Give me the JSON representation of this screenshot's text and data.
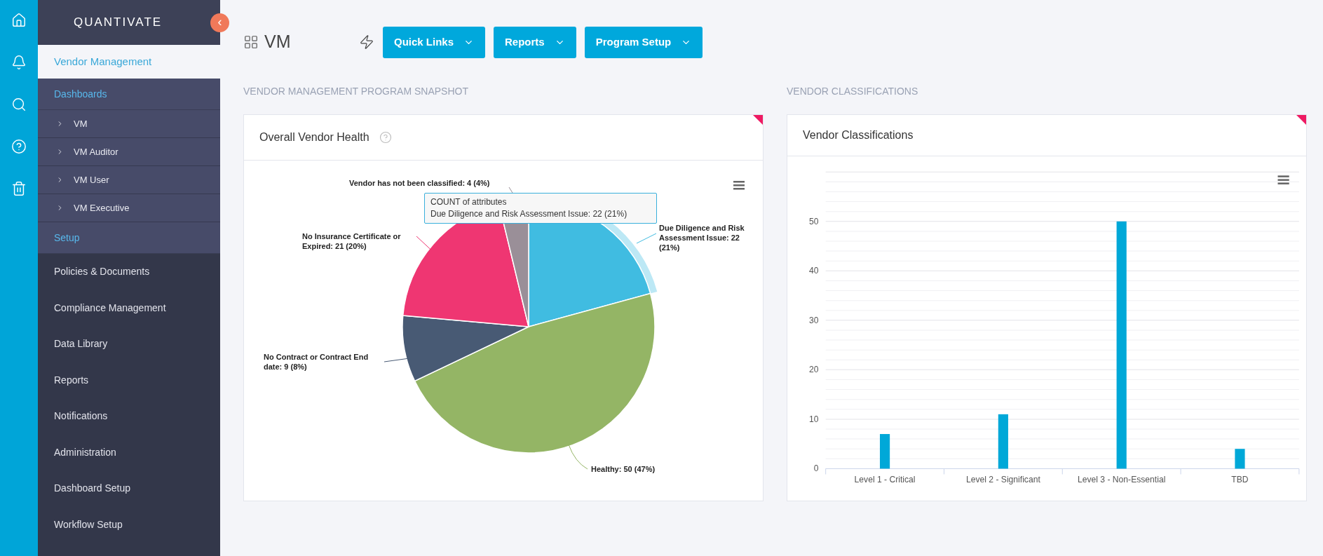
{
  "sidebar": {
    "logo": "QUANTIVATE",
    "collapse_glyph": "‹",
    "items": [
      {
        "kind": "module",
        "label": "Vendor Management"
      },
      {
        "kind": "group",
        "label": "Dashboards"
      },
      {
        "kind": "sub",
        "label": "VM"
      },
      {
        "kind": "sub",
        "label": "VM Auditor"
      },
      {
        "kind": "sub",
        "label": "VM User"
      },
      {
        "kind": "sub",
        "label": "VM Executive"
      },
      {
        "kind": "group",
        "label": "Setup"
      },
      {
        "kind": "link",
        "label": "Policies & Documents"
      },
      {
        "kind": "link",
        "label": "Compliance Management"
      },
      {
        "kind": "link",
        "label": "Data Library"
      },
      {
        "kind": "link",
        "label": "Reports"
      },
      {
        "kind": "link",
        "label": "Notifications"
      },
      {
        "kind": "link",
        "label": "Administration"
      },
      {
        "kind": "link",
        "label": "Dashboard Setup"
      },
      {
        "kind": "link",
        "label": "Workflow Setup"
      }
    ]
  },
  "header": {
    "title": "VM",
    "buttons": [
      "Quick Links",
      "Reports",
      "Program Setup"
    ]
  },
  "sections": [
    {
      "heading": "VENDOR MANAGEMENT PROGRAM SNAPSHOT",
      "card_title": "Overall Vendor Health",
      "help": true,
      "tooltip": {
        "title": "COUNT of attributes",
        "line": "Due Diligence and Risk Assessment Issue: 22 (21%)"
      },
      "chart_data": {
        "type": "pie",
        "data_labels": true,
        "categories": [
          "Due Diligence and Risk Assessment Issue",
          "Healthy",
          "No Contract or Contract End date",
          "No Insurance Certificate or Expired",
          "Vendor has not been classified"
        ],
        "values": [
          22,
          50,
          9,
          21,
          4
        ],
        "colors": [
          "#40bce1",
          "#94b565",
          "#485a74",
          "#ef3672",
          "#9a8f98"
        ],
        "value_labels": [
          "22 (21%)",
          "50 (47%)",
          "9 (8%)",
          "21 (20%)",
          "4 (4%)"
        ]
      }
    },
    {
      "heading": "VENDOR CLASSIFICATIONS",
      "card_title": "Vendor Classifications",
      "help": false,
      "chart_data": {
        "type": "bar",
        "categories": [
          "Level 1 - Critical",
          "Level 2 - Significant",
          "Level 3 - Non-Essential",
          "TBD"
        ],
        "series": [
          {
            "color": "#00a8d8",
            "values": [
              7,
              11,
              50,
              4
            ]
          }
        ],
        "ylim": [
          0,
          60
        ],
        "yticks": [
          0,
          10,
          20,
          30,
          40,
          50
        ],
        "grid": true
      }
    }
  ]
}
